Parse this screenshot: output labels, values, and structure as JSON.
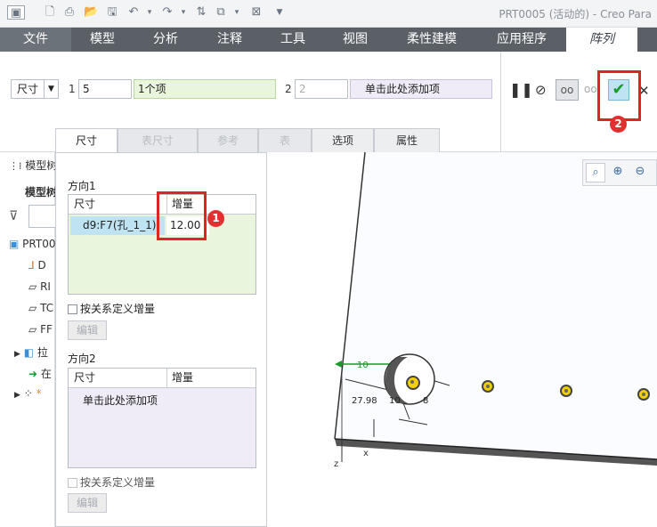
{
  "window": {
    "title": "PRT0005 (活动的) - Creo Para"
  },
  "tabs": [
    "文件",
    "模型",
    "分析",
    "注释",
    "工具",
    "视图",
    "柔性建模",
    "应用程序",
    "阵列"
  ],
  "ribbon": {
    "type_select": "尺寸",
    "dir1_label": "1",
    "dir1_count": "5",
    "dir1_items": "1个项",
    "dir2_label": "2",
    "dir2_count": "2",
    "dir2_items": "单击此处添加项"
  },
  "subtabs": [
    "尺寸",
    "表尺寸",
    "参考",
    "表",
    "选项",
    "属性"
  ],
  "panel": {
    "dir1_title": "方向1",
    "col_dim": "尺寸",
    "col_inc": "增量",
    "row_dim": "d9:F7(孔_1_1)",
    "row_inc": "12.00",
    "rel_check": "按关系定义增量",
    "edit_btn": "编辑",
    "dir2_title": "方向2",
    "col_dim2": "尺寸",
    "col_inc2": "增量",
    "dir2_add": "单击此处添加项",
    "rel_check2": "按关系定义增量",
    "edit_btn2": "编辑"
  },
  "tree": {
    "header": "模型树",
    "sub": "模型树",
    "items": [
      "PRT00",
      "D",
      "RI",
      "TC",
      "FF",
      "拉",
      "在",
      "*"
    ]
  },
  "viewport": {
    "dim1": "10",
    "dim2": "27.98",
    "dim3": "10",
    "dim4": "8"
  },
  "annotations": {
    "badge1": "1",
    "badge2": "2"
  },
  "colors": {
    "accent_red": "#e02424",
    "tab_bar": "#5b6067",
    "green_field": "#e9f5dd",
    "purple_field": "#efecf7"
  }
}
